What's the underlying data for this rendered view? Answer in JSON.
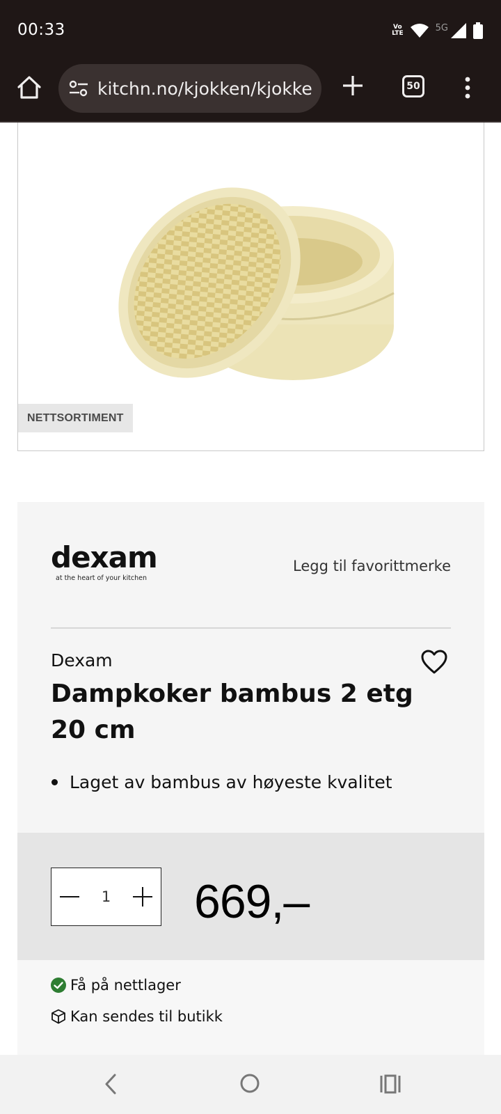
{
  "status_bar": {
    "time": "00:33",
    "volte_line1": "Vo",
    "volte_line2": "LTE",
    "network": "5G"
  },
  "browser": {
    "url": "kitchn.no/kjokken/kjokke",
    "tab_count": "50",
    "icons": [
      "home-icon",
      "site-settings-icon",
      "new-tab-icon",
      "tabs-icon",
      "more-menu-icon"
    ]
  },
  "product_image": {
    "badge": "NETTSORTIMENT"
  },
  "brand": {
    "logo_word": "dexam",
    "logo_tagline": "at the heart of your kitchen",
    "favorite_label": "Legg til favorittmerke",
    "name": "Dexam"
  },
  "product": {
    "title": "Dampkoker bambus 2 etg 20 cm",
    "features": [
      "Laget av bambus av høyeste kvalitet"
    ]
  },
  "purchase": {
    "quantity": "1",
    "price": "669,–"
  },
  "stock": {
    "online": "Få på nettlager",
    "ship_to_store": "Kan sendes til butikk",
    "online_color": "#2e7d32"
  }
}
